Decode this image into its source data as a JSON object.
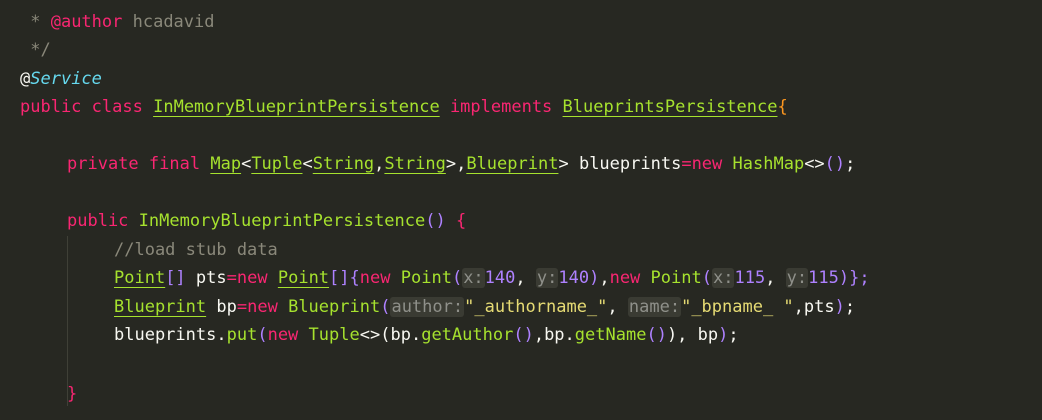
{
  "editor": {
    "theme": "dark",
    "colors": {
      "background": "#272822",
      "keyword": "#f92672",
      "type": "#a6e22e",
      "string": "#e6db74",
      "number": "#ae81ff",
      "comment": "#8a887a",
      "annotation": "#66d9ef"
    },
    "lines": {
      "l1": {
        "prefix": " * ",
        "tag": "@author",
        "rest": " hcadavid"
      },
      "l2": {
        "text": " */"
      },
      "l3": {
        "at": "@",
        "annotation": "Service"
      },
      "l4": {
        "kw1": "public",
        "kw2": "class",
        "classname": "InMemoryBlueprintPersistence",
        "kw3": "implements",
        "iface": "BlueprintsPersistence",
        "brace": "{"
      },
      "l6": {
        "kw1": "private",
        "kw2": "final",
        "t1": "Map",
        "t2": "Tuple",
        "t3": "String",
        "t4": "String",
        "t5": "Blueprint",
        "var": "blueprints",
        "op": "=",
        "kw3": "new",
        "t6": "HashMap",
        "diamond": "<>",
        "parens": "()",
        "semi": ";"
      },
      "l8": {
        "kw1": "public",
        "ctor": "InMemoryBlueprintPersistence",
        "parens": "()",
        "brace": "{"
      },
      "l9": {
        "comment": "//load stub data"
      },
      "l10": {
        "t1": "Point",
        "arr": "[]",
        "var": "pts",
        "op": "=",
        "kw": "new",
        "t2": "Point",
        "arr2": "[]",
        "brace": "{",
        "kw2": "new",
        "fn1": "Point",
        "hx1": "x:",
        "v1": "140",
        "hy1": "y:",
        "v2": "140",
        "kw3": "new",
        "fn2": "Point",
        "hx2": "x:",
        "v3": "115",
        "hy2": "y:",
        "v4": "115",
        "close": "};"
      },
      "l11": {
        "t1": "Blueprint",
        "var": "bp",
        "op": "=",
        "kw": "new",
        "fn": "Blueprint",
        "hint1": "author:",
        "s1": "\"_authorname_\"",
        "hint2": "name:",
        "s2": "\"_bpname_ \"",
        "arg": "pts",
        "end": ");"
      },
      "l12": {
        "obj": "blueprints",
        "method": "put",
        "kw": "new",
        "fn": "Tuple",
        "diamond": "<>",
        "a1": "bp",
        "m1": "getAuthor",
        "a2": "bp",
        "m2": "getName",
        "a3": "bp",
        "end": ");"
      },
      "l14": {
        "brace": "}"
      }
    }
  }
}
